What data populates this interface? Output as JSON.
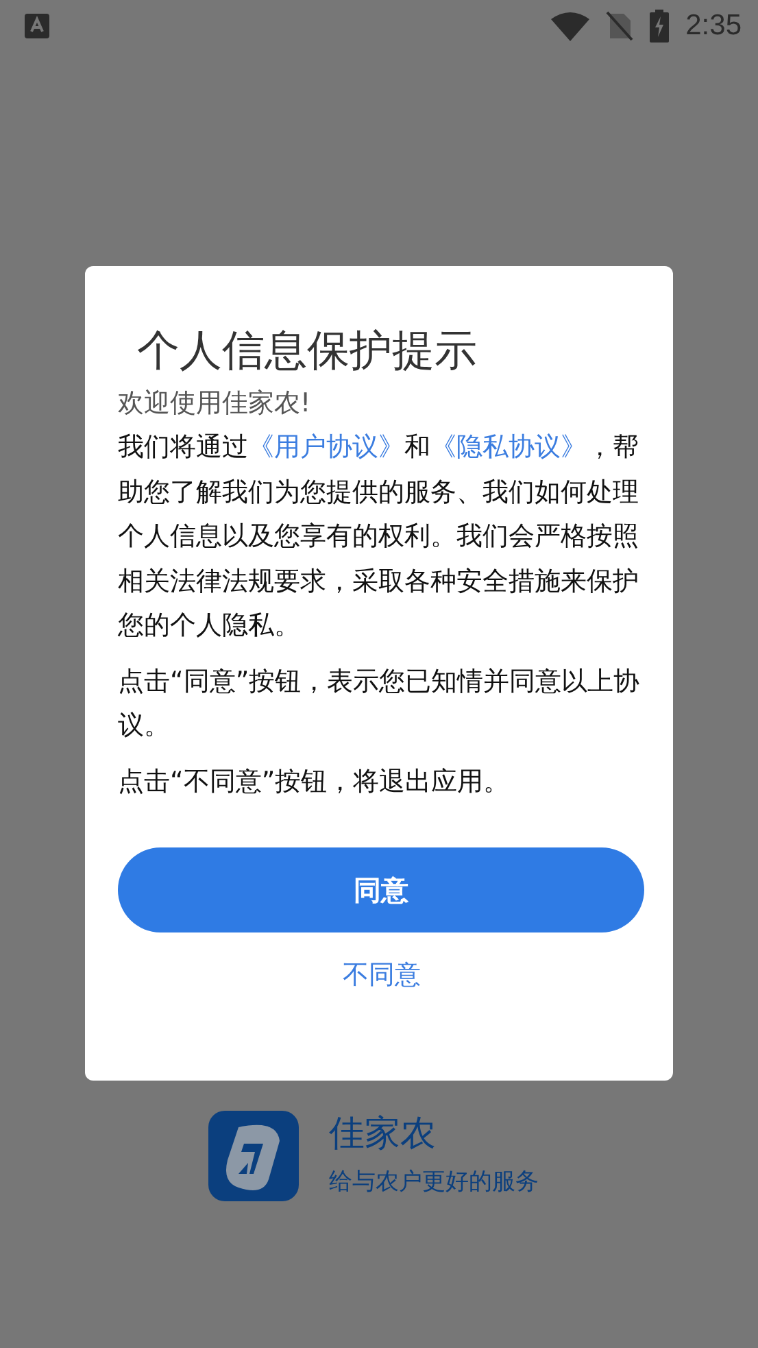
{
  "status_bar": {
    "time": "2:35"
  },
  "dialog": {
    "title": "个人信息保护提示",
    "welcome": "欢迎使用佳家农!",
    "paragraphs": [
      {
        "parts": [
          {
            "kind": "text",
            "text": "我们将通过"
          },
          {
            "kind": "link",
            "text": "《用户协议》"
          },
          {
            "kind": "text",
            "text": "和"
          },
          {
            "kind": "link",
            "text": "《隐私协议》"
          },
          {
            "kind": "text",
            "text": "，帮助您了解我们为您提供的服务、我们如何处理个人信息以及您享有的权利。我们会严格按照相关法律法规要求，采取各种安全措施来保护您的个人隐私。"
          }
        ]
      },
      {
        "parts": [
          {
            "kind": "text",
            "text": "点击“同意”按钮，表示您已知情并同意以上协议。"
          }
        ]
      },
      {
        "parts": [
          {
            "kind": "text",
            "text": "点击“不同意”按钮，将退出应用。"
          }
        ]
      }
    ],
    "agree_button": "同意",
    "decline_link": "不同意"
  },
  "splash": {
    "app_name": "佳家农",
    "slogan": "给与农户更好的服务"
  }
}
